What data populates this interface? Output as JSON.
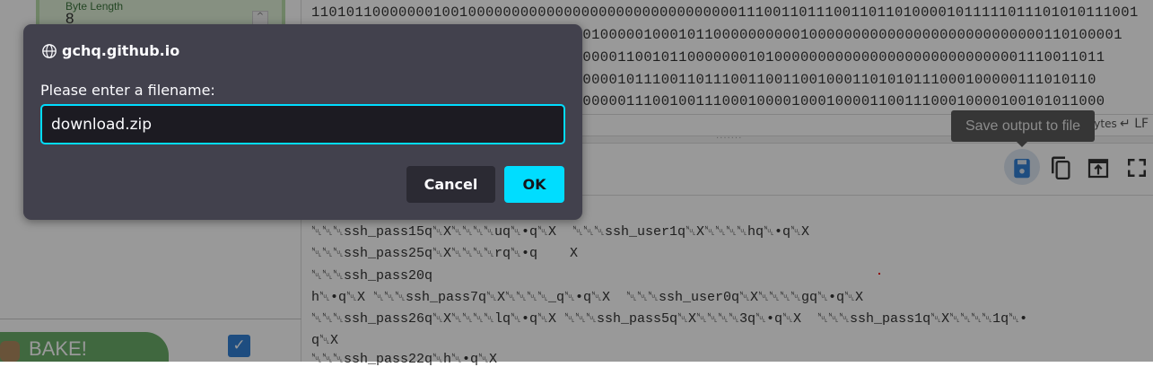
{
  "recipe": {
    "operation_arg_label": "Byte Length",
    "operation_arg_value": "8",
    "bake_label": "BAKE!",
    "auto_bake_checked": true
  },
  "input": {
    "lines": [
      "11010110000000100100000000000000000000000000000001110011011100110110100001011111011101010111001",
      "0001000001000101100000000001000000000000000000000000000110100001",
      "10000011001011000000010100000000000000000000000000001110011011",
      "1100001011100110111001100110010001101010111000100000111010110",
      "00000001110010011100010000100010000110011100010000100101011000"
    ],
    "status_raw_bytes": "Raw Bytes",
    "status_eol": "LF"
  },
  "output": {
    "tooltip": "Save output to file",
    "icons": [
      "save-icon",
      "copy-icon",
      "open-in-input-icon",
      "fullscreen-icon"
    ],
    "lines": [
      "␀␀␀ssh_pass15q␀X␀␀␀␀uq␀•q␀X  ␀␀␀ssh_user1q␀X␀␀␀␀hq␀•q␀X",
      "␀␀␀ssh_pass25q␀X␀␀␀␀rq␀•q    X",
      "␀␀␀ssh_pass20q",
      "h␀•q␀X ␀␀␀ssh_pass7q␀X␀␀␀␀_q␀•q␀X  ␀␀␀ssh_user0q␀X␀␀␀␀gq␀•q␀X",
      "␀␀␀ssh_pass26q␀X␀␀␀␀lq␀•q␀X ␀␀␀ssh_pass5q␀X␀␀␀␀3q␀•q␀X  ␀␀␀ssh_pass1q␀X␀␀␀␀1q␀•",
      "q␀X",
      "␀␀␀ssh_pass22q␀h␀•q␀X"
    ]
  },
  "dialog": {
    "host": "gchq.github.io",
    "label": "Please enter a filename:",
    "filename": "download.zip",
    "cancel_label": "Cancel",
    "ok_label": "OK",
    "accent": "#00ddff"
  }
}
